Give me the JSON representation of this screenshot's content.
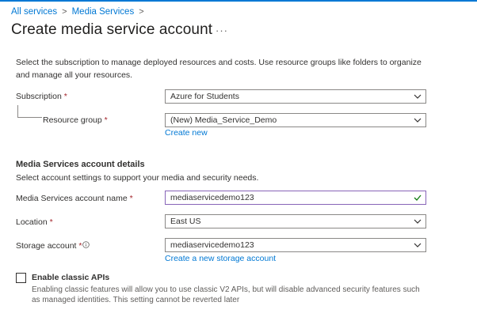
{
  "breadcrumb": {
    "items": [
      "All services",
      "Media Services"
    ]
  },
  "page": {
    "title": "Create media service account",
    "more_label": "···"
  },
  "intro": "Select the subscription to manage deployed resources and costs. Use resource groups like folders to organize and manage all your resources.",
  "subscription": {
    "label": "Subscription",
    "required": "*",
    "value": "Azure for Students"
  },
  "resource_group": {
    "label": "Resource group",
    "required": "*",
    "value": "(New) Media_Service_Demo",
    "link": "Create new"
  },
  "details": {
    "title": "Media Services account details",
    "subtitle": "Select account settings to support your media and security needs."
  },
  "account_name": {
    "label": "Media Services account name",
    "required": "*",
    "value": "mediaservicedemo123"
  },
  "location": {
    "label": "Location",
    "required": "*",
    "value": "East US"
  },
  "storage": {
    "label": "Storage account",
    "required": "*",
    "value": "mediaservicedemo123",
    "link": "Create a new storage account"
  },
  "classic_apis": {
    "label": "Enable classic APIs",
    "checked": false,
    "description": "Enabling classic features will allow you to use classic V2 APIs, but will disable advanced security features such as managed identities. This setting cannot be reverted later"
  },
  "colors": {
    "accent": "#0078d4",
    "required": "#a4262c",
    "valid_border": "#8764b8",
    "check": "#107c10"
  }
}
